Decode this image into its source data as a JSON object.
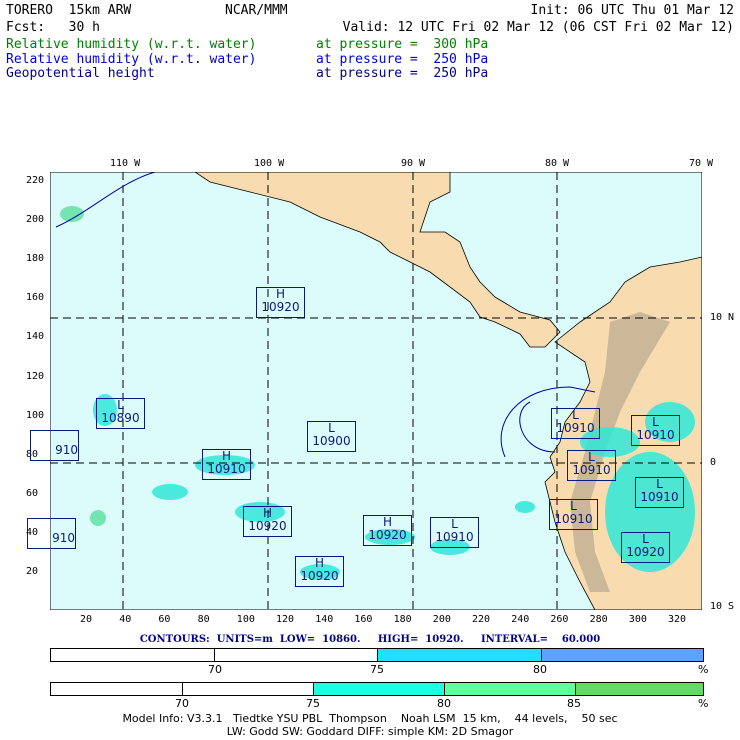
{
  "header": {
    "model": "TORERO  15km ARW",
    "org": "NCAR/MMM",
    "init": "Init: 06 UTC Thu 01 Mar 12",
    "fcst": "Fcst:   30 h",
    "valid": "Valid: 12 UTC Fri 02 Mar 12 (06 CST Fri 02 Mar 12)",
    "fields": [
      {
        "name": "Relative humidity (w.r.t. water)",
        "level": "at pressure =  300 hPa",
        "color": "#008000"
      },
      {
        "name": "Relative humidity (w.r.t. water)",
        "level": "at pressure =  250 hPa",
        "color": "#0000dd"
      },
      {
        "name": "Geopotential height",
        "level": "at pressure =  250 hPa",
        "color": "#000088"
      }
    ]
  },
  "map": {
    "top_lon_labels": [
      "110 W",
      "100 W",
      "90 W",
      "80 W",
      "70 W"
    ],
    "right_lat_labels": [
      "10 N",
      "0",
      "10 S"
    ],
    "left_ticks": [
      "220",
      "200",
      "180",
      "160",
      "140",
      "120",
      "100",
      "80",
      "60",
      "40",
      "20"
    ],
    "bottom_ticks": [
      "20",
      "40",
      "60",
      "80",
      "100",
      "120",
      "140",
      "160",
      "180",
      "200",
      "220",
      "240",
      "260",
      "280",
      "300",
      "320"
    ],
    "centers": [
      {
        "type": "H",
        "value": "10920"
      },
      {
        "type": "L",
        "value": "10890"
      },
      {
        "type": "",
        "value": "910"
      },
      {
        "type": "L",
        "value": "10900"
      },
      {
        "type": "H",
        "value": "10910"
      },
      {
        "type": "H",
        "value": "10920"
      },
      {
        "type": "H",
        "value": "10920"
      },
      {
        "type": "L",
        "value": "10910"
      },
      {
        "type": "H",
        "value": "10920"
      },
      {
        "type": "",
        "value": "910"
      },
      {
        "type": "L",
        "value": "10910"
      },
      {
        "type": "L",
        "value": "10910"
      },
      {
        "type": "L",
        "value": "10910"
      },
      {
        "type": "L",
        "value": "10910"
      },
      {
        "type": "L",
        "value": "10910"
      },
      {
        "type": "L",
        "value": "10920"
      }
    ],
    "colors": {
      "ocean": "#dcfcfc",
      "land": "#f8dcb0",
      "contour": "#0a1a7a"
    }
  },
  "contours_text": "CONTOURS:  UNITS=m  LOW=  10860.     HIGH=  10920.     INTERVAL=    60.000",
  "colorbar_250": {
    "ticks": [
      "70",
      "75",
      "80",
      "%"
    ],
    "colors": [
      "#ffffff",
      "#ffffff",
      "#20e0f8",
      "#60a0ff"
    ]
  },
  "colorbar_300": {
    "ticks": [
      "70",
      "75",
      "80",
      "85",
      "%"
    ],
    "colors": [
      "#ffffff",
      "#ffffff",
      "#20ffe0",
      "#60ff9c",
      "#60dc60"
    ]
  },
  "model_info": {
    "line1": "Model Info: V3.3.1   Tiedtke YSU PBL  Thompson    Noah LSM  15 km,    44 levels,    50 sec",
    "line2": "LW: Godd SW: Goddard DIFF: simple KM: 2D Smagor"
  }
}
